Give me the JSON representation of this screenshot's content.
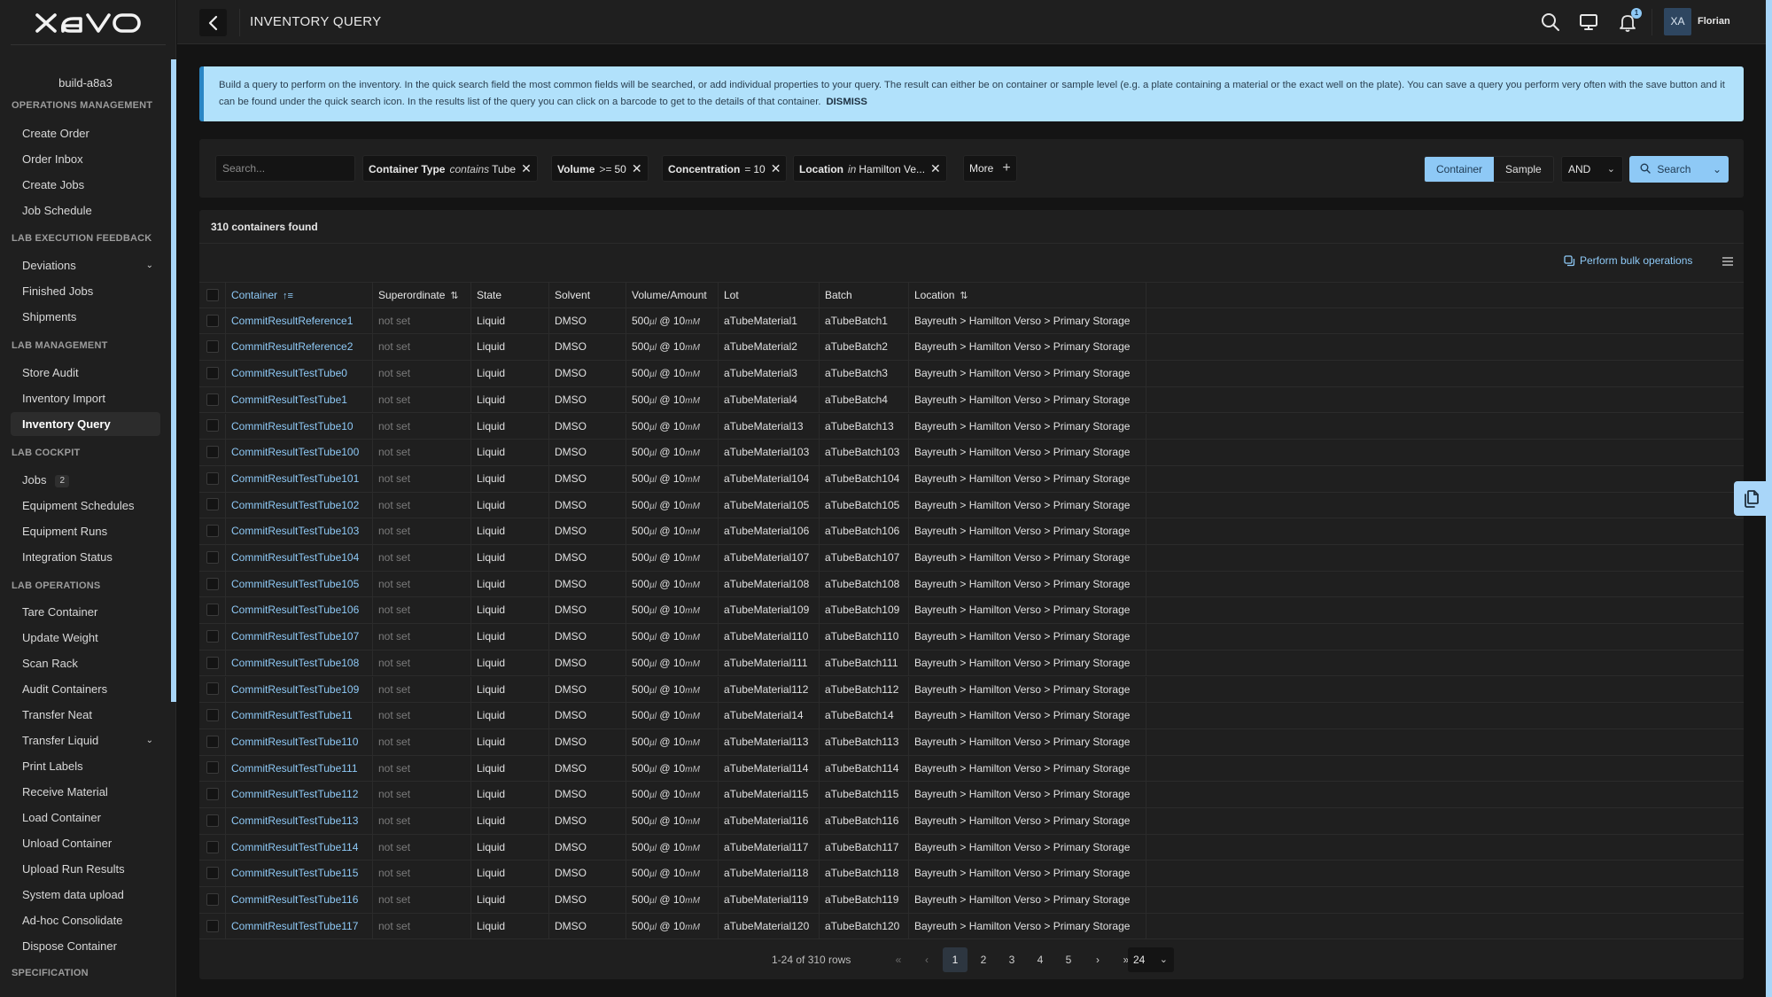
{
  "app": {
    "logo": "xavo",
    "workspace": "build-a8a3"
  },
  "header": {
    "title": "INVENTORY QUERY",
    "notification_count": "1",
    "user_initials": "XA",
    "user_name": "Florian"
  },
  "sidebar": {
    "sections": [
      {
        "title": "OPERATIONS MANAGEMENT",
        "items": [
          {
            "label": "Create Order"
          },
          {
            "label": "Order Inbox"
          },
          {
            "label": "Create Jobs"
          },
          {
            "label": "Job Schedule"
          }
        ]
      },
      {
        "title": "LAB EXECUTION FEEDBACK",
        "items": [
          {
            "label": "Deviations",
            "expandable": true
          },
          {
            "label": "Finished Jobs"
          },
          {
            "label": "Shipments"
          }
        ]
      },
      {
        "title": "LAB MANAGEMENT",
        "items": [
          {
            "label": "Store Audit"
          },
          {
            "label": "Inventory Import"
          },
          {
            "label": "Inventory Query",
            "active": true
          }
        ]
      },
      {
        "title": "LAB COCKPIT",
        "items": [
          {
            "label": "Jobs",
            "badge": "2"
          },
          {
            "label": "Equipment Schedules"
          },
          {
            "label": "Equipment Runs"
          },
          {
            "label": "Integration Status"
          }
        ]
      },
      {
        "title": "LAB OPERATIONS",
        "items": [
          {
            "label": "Tare Container"
          },
          {
            "label": "Update Weight"
          },
          {
            "label": "Scan Rack"
          },
          {
            "label": "Audit Containers"
          },
          {
            "label": "Transfer Neat"
          },
          {
            "label": "Transfer Liquid",
            "expandable": true
          },
          {
            "label": "Print Labels"
          },
          {
            "label": "Receive Material"
          },
          {
            "label": "Load Container"
          },
          {
            "label": "Unload Container"
          },
          {
            "label": "Upload Run Results"
          },
          {
            "label": "System data upload"
          },
          {
            "label": "Ad-hoc Consolidate"
          },
          {
            "label": "Dispose Container"
          }
        ]
      },
      {
        "title": "SPECIFICATION",
        "items": []
      }
    ]
  },
  "banner": {
    "text": "Build a query to perform on the inventory. In the quick search field the most common fields will be searched, or add individual properties to your query. The result can either be on container or sample level (e.g. a plate containing a material or the exact well on the plate). You can save a query you perform very often with the save button and it can be found under the quick search icon. In the results list of the query you can click on a barcode to get to the details of that container.",
    "dismiss_label": "DISMISS"
  },
  "filters": {
    "search_placeholder": "Search...",
    "search_value": "",
    "chips": [
      {
        "field": "Container Type",
        "operator": "contains",
        "operator_italic": true,
        "value": "Tube"
      },
      {
        "field": "Volume",
        "operator": ">=",
        "operator_italic": false,
        "value": "50"
      },
      {
        "field": "Concentration",
        "operator": "=",
        "operator_italic": false,
        "value": "10"
      },
      {
        "field": "Location",
        "operator": "in",
        "operator_italic": true,
        "value": "Hamilton Ve..."
      }
    ],
    "more_label": "More",
    "level_options": [
      "Container",
      "Sample"
    ],
    "level_selected": "Container",
    "logic_selected": "AND",
    "search_button_label": "Search"
  },
  "results": {
    "count_text": "310 containers found",
    "bulk_ops_label": "Perform bulk operations",
    "columns": [
      "Container",
      "Superordinate",
      "State",
      "Solvent",
      "Volume/Amount",
      "Lot",
      "Batch",
      "Location"
    ],
    "rows": [
      {
        "container": "CommitResultReference1",
        "superordinate": "not set",
        "state": "Liquid",
        "solvent": "DMSO",
        "volume": "500",
        "volume_unit": "µl",
        "conc": "10",
        "conc_unit": "mM",
        "lot": "aTubeMaterial1",
        "batch": "aTubeBatch1",
        "location": "Bayreuth > Hamilton Verso > Primary Storage"
      },
      {
        "container": "CommitResultReference2",
        "superordinate": "not set",
        "state": "Liquid",
        "solvent": "DMSO",
        "volume": "500",
        "volume_unit": "µl",
        "conc": "10",
        "conc_unit": "mM",
        "lot": "aTubeMaterial2",
        "batch": "aTubeBatch2",
        "location": "Bayreuth > Hamilton Verso > Primary Storage"
      },
      {
        "container": "CommitResultTestTube0",
        "superordinate": "not set",
        "state": "Liquid",
        "solvent": "DMSO",
        "volume": "500",
        "volume_unit": "µl",
        "conc": "10",
        "conc_unit": "mM",
        "lot": "aTubeMaterial3",
        "batch": "aTubeBatch3",
        "location": "Bayreuth > Hamilton Verso > Primary Storage"
      },
      {
        "container": "CommitResultTestTube1",
        "superordinate": "not set",
        "state": "Liquid",
        "solvent": "DMSO",
        "volume": "500",
        "volume_unit": "µl",
        "conc": "10",
        "conc_unit": "mM",
        "lot": "aTubeMaterial4",
        "batch": "aTubeBatch4",
        "location": "Bayreuth > Hamilton Verso > Primary Storage"
      },
      {
        "container": "CommitResultTestTube10",
        "superordinate": "not set",
        "state": "Liquid",
        "solvent": "DMSO",
        "volume": "500",
        "volume_unit": "µl",
        "conc": "10",
        "conc_unit": "mM",
        "lot": "aTubeMaterial13",
        "batch": "aTubeBatch13",
        "location": "Bayreuth > Hamilton Verso > Primary Storage"
      },
      {
        "container": "CommitResultTestTube100",
        "superordinate": "not set",
        "state": "Liquid",
        "solvent": "DMSO",
        "volume": "500",
        "volume_unit": "µl",
        "conc": "10",
        "conc_unit": "mM",
        "lot": "aTubeMaterial103",
        "batch": "aTubeBatch103",
        "location": "Bayreuth > Hamilton Verso > Primary Storage"
      },
      {
        "container": "CommitResultTestTube101",
        "superordinate": "not set",
        "state": "Liquid",
        "solvent": "DMSO",
        "volume": "500",
        "volume_unit": "µl",
        "conc": "10",
        "conc_unit": "mM",
        "lot": "aTubeMaterial104",
        "batch": "aTubeBatch104",
        "location": "Bayreuth > Hamilton Verso > Primary Storage"
      },
      {
        "container": "CommitResultTestTube102",
        "superordinate": "not set",
        "state": "Liquid",
        "solvent": "DMSO",
        "volume": "500",
        "volume_unit": "µl",
        "conc": "10",
        "conc_unit": "mM",
        "lot": "aTubeMaterial105",
        "batch": "aTubeBatch105",
        "location": "Bayreuth > Hamilton Verso > Primary Storage"
      },
      {
        "container": "CommitResultTestTube103",
        "superordinate": "not set",
        "state": "Liquid",
        "solvent": "DMSO",
        "volume": "500",
        "volume_unit": "µl",
        "conc": "10",
        "conc_unit": "mM",
        "lot": "aTubeMaterial106",
        "batch": "aTubeBatch106",
        "location": "Bayreuth > Hamilton Verso > Primary Storage"
      },
      {
        "container": "CommitResultTestTube104",
        "superordinate": "not set",
        "state": "Liquid",
        "solvent": "DMSO",
        "volume": "500",
        "volume_unit": "µl",
        "conc": "10",
        "conc_unit": "mM",
        "lot": "aTubeMaterial107",
        "batch": "aTubeBatch107",
        "location": "Bayreuth > Hamilton Verso > Primary Storage"
      },
      {
        "container": "CommitResultTestTube105",
        "superordinate": "not set",
        "state": "Liquid",
        "solvent": "DMSO",
        "volume": "500",
        "volume_unit": "µl",
        "conc": "10",
        "conc_unit": "mM",
        "lot": "aTubeMaterial108",
        "batch": "aTubeBatch108",
        "location": "Bayreuth > Hamilton Verso > Primary Storage"
      },
      {
        "container": "CommitResultTestTube106",
        "superordinate": "not set",
        "state": "Liquid",
        "solvent": "DMSO",
        "volume": "500",
        "volume_unit": "µl",
        "conc": "10",
        "conc_unit": "mM",
        "lot": "aTubeMaterial109",
        "batch": "aTubeBatch109",
        "location": "Bayreuth > Hamilton Verso > Primary Storage"
      },
      {
        "container": "CommitResultTestTube107",
        "superordinate": "not set",
        "state": "Liquid",
        "solvent": "DMSO",
        "volume": "500",
        "volume_unit": "µl",
        "conc": "10",
        "conc_unit": "mM",
        "lot": "aTubeMaterial110",
        "batch": "aTubeBatch110",
        "location": "Bayreuth > Hamilton Verso > Primary Storage"
      },
      {
        "container": "CommitResultTestTube108",
        "superordinate": "not set",
        "state": "Liquid",
        "solvent": "DMSO",
        "volume": "500",
        "volume_unit": "µl",
        "conc": "10",
        "conc_unit": "mM",
        "lot": "aTubeMaterial111",
        "batch": "aTubeBatch111",
        "location": "Bayreuth > Hamilton Verso > Primary Storage"
      },
      {
        "container": "CommitResultTestTube109",
        "superordinate": "not set",
        "state": "Liquid",
        "solvent": "DMSO",
        "volume": "500",
        "volume_unit": "µl",
        "conc": "10",
        "conc_unit": "mM",
        "lot": "aTubeMaterial112",
        "batch": "aTubeBatch112",
        "location": "Bayreuth > Hamilton Verso > Primary Storage"
      },
      {
        "container": "CommitResultTestTube11",
        "superordinate": "not set",
        "state": "Liquid",
        "solvent": "DMSO",
        "volume": "500",
        "volume_unit": "µl",
        "conc": "10",
        "conc_unit": "mM",
        "lot": "aTubeMaterial14",
        "batch": "aTubeBatch14",
        "location": "Bayreuth > Hamilton Verso > Primary Storage"
      },
      {
        "container": "CommitResultTestTube110",
        "superordinate": "not set",
        "state": "Liquid",
        "solvent": "DMSO",
        "volume": "500",
        "volume_unit": "µl",
        "conc": "10",
        "conc_unit": "mM",
        "lot": "aTubeMaterial113",
        "batch": "aTubeBatch113",
        "location": "Bayreuth > Hamilton Verso > Primary Storage"
      },
      {
        "container": "CommitResultTestTube111",
        "superordinate": "not set",
        "state": "Liquid",
        "solvent": "DMSO",
        "volume": "500",
        "volume_unit": "µl",
        "conc": "10",
        "conc_unit": "mM",
        "lot": "aTubeMaterial114",
        "batch": "aTubeBatch114",
        "location": "Bayreuth > Hamilton Verso > Primary Storage"
      },
      {
        "container": "CommitResultTestTube112",
        "superordinate": "not set",
        "state": "Liquid",
        "solvent": "DMSO",
        "volume": "500",
        "volume_unit": "µl",
        "conc": "10",
        "conc_unit": "mM",
        "lot": "aTubeMaterial115",
        "batch": "aTubeBatch115",
        "location": "Bayreuth > Hamilton Verso > Primary Storage"
      },
      {
        "container": "CommitResultTestTube113",
        "superordinate": "not set",
        "state": "Liquid",
        "solvent": "DMSO",
        "volume": "500",
        "volume_unit": "µl",
        "conc": "10",
        "conc_unit": "mM",
        "lot": "aTubeMaterial116",
        "batch": "aTubeBatch116",
        "location": "Bayreuth > Hamilton Verso > Primary Storage"
      },
      {
        "container": "CommitResultTestTube114",
        "superordinate": "not set",
        "state": "Liquid",
        "solvent": "DMSO",
        "volume": "500",
        "volume_unit": "µl",
        "conc": "10",
        "conc_unit": "mM",
        "lot": "aTubeMaterial117",
        "batch": "aTubeBatch117",
        "location": "Bayreuth > Hamilton Verso > Primary Storage"
      },
      {
        "container": "CommitResultTestTube115",
        "superordinate": "not set",
        "state": "Liquid",
        "solvent": "DMSO",
        "volume": "500",
        "volume_unit": "µl",
        "conc": "10",
        "conc_unit": "mM",
        "lot": "aTubeMaterial118",
        "batch": "aTubeBatch118",
        "location": "Bayreuth > Hamilton Verso > Primary Storage"
      },
      {
        "container": "CommitResultTestTube116",
        "superordinate": "not set",
        "state": "Liquid",
        "solvent": "DMSO",
        "volume": "500",
        "volume_unit": "µl",
        "conc": "10",
        "conc_unit": "mM",
        "lot": "aTubeMaterial119",
        "batch": "aTubeBatch119",
        "location": "Bayreuth > Hamilton Verso > Primary Storage"
      },
      {
        "container": "CommitResultTestTube117",
        "superordinate": "not set",
        "state": "Liquid",
        "solvent": "DMSO",
        "volume": "500",
        "volume_unit": "µl",
        "conc": "10",
        "conc_unit": "mM",
        "lot": "aTubeMaterial120",
        "batch": "aTubeBatch120",
        "location": "Bayreuth > Hamilton Verso > Primary Storage"
      }
    ],
    "pagination": {
      "range_text": "1-24 of 310 rows",
      "pages": [
        "1",
        "2",
        "3",
        "4",
        "5"
      ],
      "current_page": "1",
      "page_size": "24"
    }
  },
  "colors": {
    "accent": "#8ec9f6",
    "banner_bg": "#b1e1fb",
    "banner_border": "#2a86c5",
    "background": "#141414",
    "panel": "#1f1f1f"
  }
}
